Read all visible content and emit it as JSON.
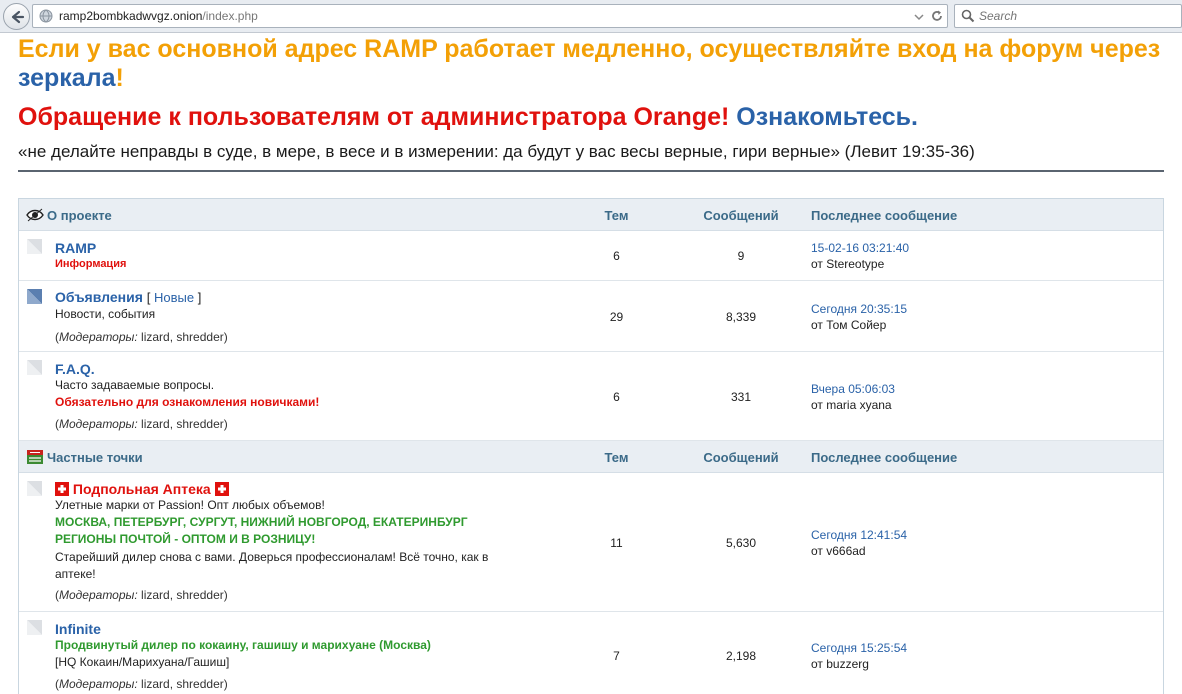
{
  "browser": {
    "url_host": "ramp2bombkadwvgz.onion",
    "url_path": "/index.php",
    "search_placeholder": "Search"
  },
  "header": {
    "notice_text": "Если у вас основной адрес RAMP работает медленно, осуществляйте вход на форум через ",
    "notice_link": "зеркала",
    "notice_end": "!",
    "appeal_text": "Обращение к пользователям от администратора Orange! ",
    "appeal_link": "Ознакомьтесь.",
    "quote": "«не делайте неправды в суде, в мере, в весе и в измерении: да будут у вас весы верные, гири верные» (Левит 19:35-36)"
  },
  "categories": [
    {
      "title": "О проекте",
      "col_topics": "Тем",
      "col_posts": "Сообщений",
      "col_last": "Последнее сообщение",
      "forums": [
        {
          "title": "RAMP",
          "line1_red": "Информация",
          "topics": "6",
          "posts": "9",
          "last_date": "15-02-16 03:21:40",
          "last_by": "от Stereotype"
        },
        {
          "title": "Объявления",
          "new_open": "[ ",
          "new_label": "Новые",
          "new_close": " ]",
          "desc": "Новости, события",
          "mods_label": "Модераторы:",
          "mods_names": " lizard, shredder)",
          "topics": "29",
          "posts": "8,339",
          "last_date": "Сегодня 20:35:15",
          "last_by": "от Том Сойер"
        },
        {
          "title": "F.A.Q.",
          "desc": "Часто задаваемые вопросы.",
          "desc_red": "Обязательно для ознакомления новичками!",
          "mods_label": "Модераторы:",
          "mods_names": " lizard, shredder)",
          "topics": "6",
          "posts": "331",
          "last_date": "Вчера 05:06:03",
          "last_by": "от maria xyana"
        }
      ]
    },
    {
      "title": "Частные точки",
      "col_topics": "Тем",
      "col_posts": "Сообщений",
      "col_last": "Последнее сообщение",
      "forums": [
        {
          "title": "Подпольная Аптека",
          "desc": "Улетные марки от Passion! Опт любых объемов!",
          "green1": "МОСКВА, ПЕТЕРБУРГ, СУРГУТ, НИЖНИЙ НОВГОРОД, ЕКАТЕРИНБУРГ",
          "green2": "РЕГИОНЫ ПОЧТОЙ - ОПТОМ И В РОЗНИЦУ!",
          "desc2": "Старейший дилер снова с вами. Доверься профессионалам! Всё точно, как в аптеке!",
          "mods_label": "Модераторы:",
          "mods_names": " lizard, shredder)",
          "topics": "11",
          "posts": "5,630",
          "last_date": "Сегодня 12:41:54",
          "last_by": "от v666ad"
        },
        {
          "title": "Infinite",
          "green1": "Продвинутый дилер по кокаину, гашишу и марихуане (Москва)",
          "desc": "[HQ Кокаин/Марихуана/Гашиш]",
          "mods_label": "Модераторы:",
          "mods_names": " lizard, shredder)",
          "topics": "7",
          "posts": "2,198",
          "last_date": "Сегодня 15:25:54",
          "last_by": "от buzzerg"
        }
      ]
    }
  ],
  "colors": {
    "notice": "#f3a006",
    "link": "#2a62a8",
    "alert": "#e0110d",
    "green": "#2f9a2f",
    "header_bg": "#e9eef3"
  }
}
